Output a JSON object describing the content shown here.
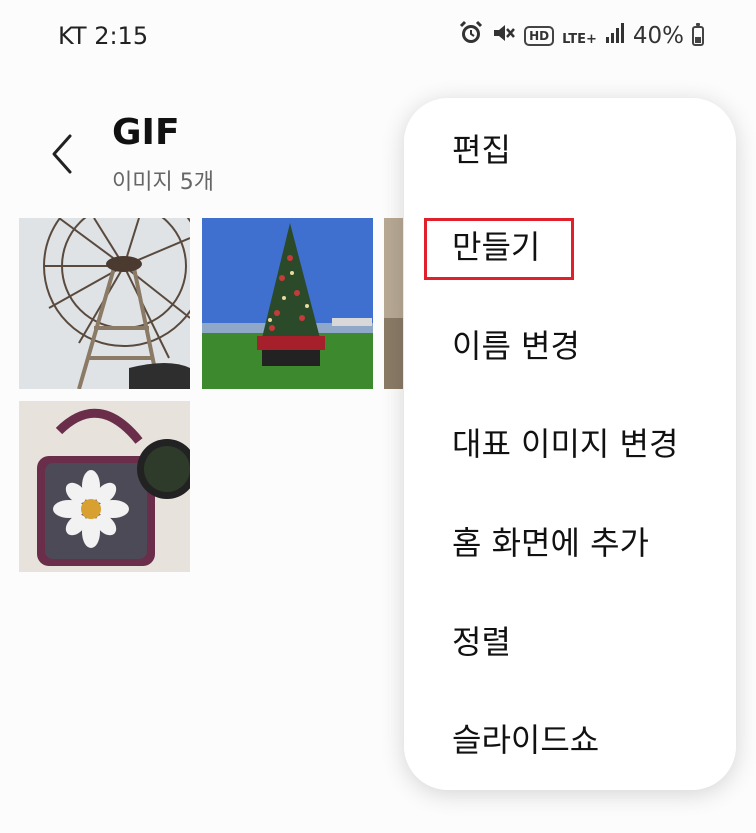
{
  "status_bar": {
    "carrier": "KT",
    "time": "2:15",
    "icons": [
      "alarm-icon",
      "mute-icon",
      "hd-voice-icon",
      "lte-signal-icon",
      "cell-signal-icon",
      "battery-icon"
    ],
    "hd_label": "HD",
    "lte_label": "LTE+",
    "battery_percent": "40%",
    "battery_level": 0.4
  },
  "header": {
    "back_icon": "chevron-left-icon",
    "title": "GIF",
    "subtitle": "이미지 5개"
  },
  "menu": {
    "items": [
      {
        "label": "편집"
      },
      {
        "label": "만들기"
      },
      {
        "label": "이름 변경"
      },
      {
        "label": "대표 이미지 변경"
      },
      {
        "label": "홈 화면에 추가"
      },
      {
        "label": "정렬"
      },
      {
        "label": "슬라이드쇼"
      }
    ],
    "highlighted_index": 1
  },
  "colors": {
    "highlight": "#e0202a",
    "background": "#fcfcfc",
    "subtitle": "#666666"
  }
}
